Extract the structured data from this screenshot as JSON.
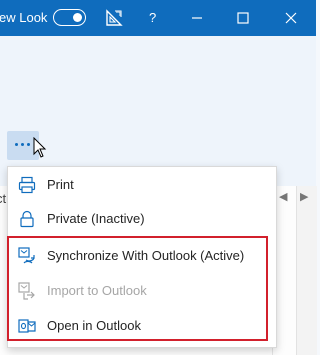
{
  "titlebar": {
    "new_look_label": "ew Look",
    "help_label": "?",
    "toggle_state": "on"
  },
  "more_button": {
    "icon": "more-horizontal-icon"
  },
  "partial_text": "ct",
  "menu": {
    "items": [
      {
        "label": "Print",
        "icon": "print-icon",
        "enabled": true
      },
      {
        "label": "Private (Inactive)",
        "icon": "lock-icon",
        "enabled": true
      },
      {
        "label": "Synchronize With Outlook (Active)",
        "icon": "sync-outlook-icon",
        "enabled": true
      },
      {
        "label": "Import to Outlook",
        "icon": "import-outlook-icon",
        "enabled": false
      },
      {
        "label": "Open in Outlook",
        "icon": "outlook-icon",
        "enabled": true
      }
    ]
  },
  "colors": {
    "titlebar": "#0f6cbd",
    "accent": "#0f6cbd",
    "highlight": "#d2202c"
  }
}
